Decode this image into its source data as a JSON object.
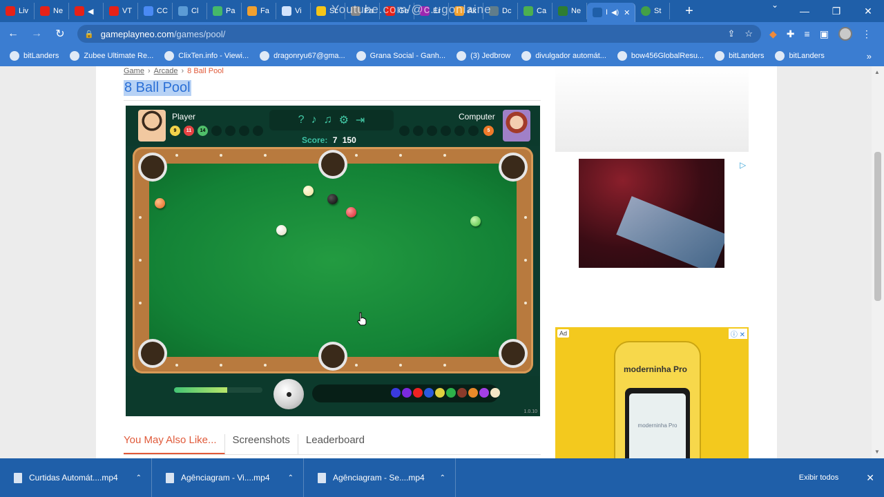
{
  "browser": {
    "tabs": [
      {
        "label": "Liv",
        "color": "#e62117"
      },
      {
        "label": "Ne",
        "color": "#e62117"
      },
      {
        "label": "◀",
        "color": "#e62117"
      },
      {
        "label": "VT",
        "color": "#e62117"
      },
      {
        "label": "CC",
        "color": "#4a8af4"
      },
      {
        "label": "Cl",
        "color": "#5b9bd5"
      },
      {
        "label": "Pa",
        "color": "#45b86a"
      },
      {
        "label": "Fa",
        "color": "#f0a030"
      },
      {
        "label": "Vi",
        "color": "#d2e3fc"
      },
      {
        "label": "Sc",
        "color": "#f5c518"
      },
      {
        "label": "Pa",
        "color": "#888888"
      },
      {
        "label": "Ge",
        "color": "#e62117"
      },
      {
        "label": "Er",
        "color": "#9c27b0"
      },
      {
        "label": "Ak",
        "color": "#f0a030"
      },
      {
        "label": "Dc",
        "color": "#607d8b"
      },
      {
        "label": "Ca",
        "color": "#4caf50"
      },
      {
        "label": "Ne",
        "color": "#2e7d32"
      }
    ],
    "active_tab": {
      "label": "I"
    },
    "last_tab": {
      "label": "St",
      "color": "#43a047"
    },
    "watermark": "Youtube.com/@c.ugonlaine",
    "address": {
      "host": "gameplayneo.com",
      "path": "/games/pool/"
    },
    "bookmarks": [
      {
        "label": "bitLanders"
      },
      {
        "label": "Zubee Ultimate Re..."
      },
      {
        "label": "ClixTen.info - Viewi..."
      },
      {
        "label": "dragonryu67@gma..."
      },
      {
        "label": "Grana Social - Ganh..."
      },
      {
        "label": "(3) Jedbrow"
      },
      {
        "label": "divulgador automát..."
      },
      {
        "label": "bow456GlobalResu..."
      },
      {
        "label": "bitLanders"
      },
      {
        "label": "bitLanders"
      }
    ]
  },
  "page": {
    "breadcrumb": [
      "Game",
      "Arcade",
      "8 Ball Pool"
    ],
    "breadcrumb_sep": "›",
    "title": "8 Ball Pool",
    "game": {
      "player_label": "Player",
      "computer_label": "Computer",
      "player_balls": [
        "9",
        "11",
        "14"
      ],
      "computer_balls": [
        "5"
      ],
      "score_label": "Score:",
      "score_value": "7",
      "score_target": "150",
      "version": "1.0.10",
      "power_level": 0.6
    },
    "tabs": [
      "You May Also Like...",
      "Screenshots",
      "Leaderboard"
    ],
    "ads": {
      "ad_label": "Ad",
      "brand": "moderninha Pro"
    }
  },
  "downloads": {
    "items": [
      {
        "label": "Curtidas Automát....mp4"
      },
      {
        "label": "Agênciagram - Vi....mp4"
      },
      {
        "label": "Agênciagram - Se....mp4"
      }
    ],
    "show_all": "Exibir todos"
  }
}
